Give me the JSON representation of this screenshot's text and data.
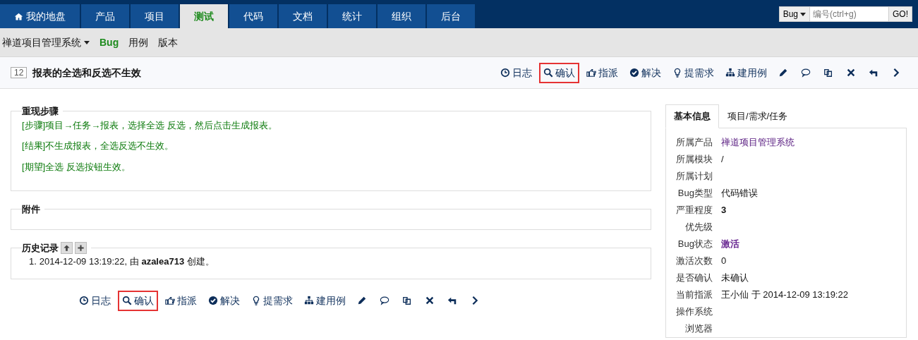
{
  "main_nav": {
    "items": [
      {
        "label": "我的地盘",
        "kind": "home",
        "selected": false
      },
      {
        "label": "产品",
        "kind": "plain",
        "selected": false
      },
      {
        "label": "项目",
        "kind": "plain",
        "selected": false
      },
      {
        "label": "测试",
        "kind": "plain",
        "selected": true
      },
      {
        "label": "代码",
        "kind": "plain",
        "selected": false
      },
      {
        "label": "文档",
        "kind": "plain",
        "selected": false
      },
      {
        "label": "统计",
        "kind": "plain",
        "selected": false
      },
      {
        "label": "组织",
        "kind": "plain",
        "selected": false
      },
      {
        "label": "后台",
        "kind": "plain",
        "selected": false
      }
    ],
    "search": {
      "type": "Bug",
      "placeholder": "编号(ctrl+g)",
      "button": "GO!"
    }
  },
  "sub_nav": {
    "product": "禅道项目管理系统",
    "items": [
      {
        "label": "Bug",
        "selected": true
      },
      {
        "label": "用例",
        "selected": false
      },
      {
        "label": "版本",
        "selected": false
      }
    ]
  },
  "title_bar": {
    "id": "12",
    "title": "报表的全选和反选不生效"
  },
  "toolbars": [
    {
      "actions": [
        {
          "kind": "clock",
          "label": "日志",
          "highlighted": false
        },
        {
          "kind": "search",
          "label": "确认",
          "highlighted": true
        },
        {
          "kind": "thumb",
          "label": "指派",
          "highlighted": false
        },
        {
          "kind": "check",
          "label": "解决",
          "highlighted": false
        },
        {
          "kind": "bulb",
          "label": "提需求",
          "highlighted": false
        },
        {
          "kind": "sitemap",
          "label": "建用例",
          "highlighted": false
        },
        {
          "kind": "pencil",
          "highlighted": false
        },
        {
          "kind": "comment",
          "highlighted": false
        },
        {
          "kind": "copy",
          "highlighted": false
        },
        {
          "kind": "close",
          "highlighted": false
        },
        {
          "kind": "back",
          "highlighted": false
        },
        {
          "kind": "next",
          "highlighted": false
        }
      ]
    },
    {
      "actions": [
        {
          "kind": "clock",
          "label": "日志",
          "highlighted": false
        },
        {
          "kind": "search",
          "label": "确认",
          "highlighted": true
        },
        {
          "kind": "thumb",
          "label": "指派",
          "highlighted": false
        },
        {
          "kind": "check",
          "label": "解决",
          "highlighted": false
        },
        {
          "kind": "bulb",
          "label": "提需求",
          "highlighted": false
        },
        {
          "kind": "sitemap",
          "label": "建用例",
          "highlighted": false
        },
        {
          "kind": "pencil",
          "highlighted": false
        },
        {
          "kind": "comment",
          "highlighted": false
        },
        {
          "kind": "copy",
          "highlighted": false
        },
        {
          "kind": "close",
          "highlighted": false
        },
        {
          "kind": "back",
          "highlighted": false
        },
        {
          "kind": "next",
          "highlighted": false
        }
      ]
    }
  ],
  "steps": {
    "legend": "重现步骤",
    "lines": [
      "[步骤]项目→任务→报表，选择全选 反选，然后点击生成报表。",
      "[结果]不生成报表，全选反选不生效。",
      "[期望]全选 反选按钮生效。"
    ]
  },
  "attachments": {
    "legend": "附件"
  },
  "history": {
    "legend": "历史记录",
    "entries": [
      {
        "number": "1.",
        "text": "2014-12-09 13:19:22, 由 **azalea713** 创建。"
      }
    ]
  },
  "side_panel": {
    "tabs": [
      {
        "label": "基本信息",
        "selected": true
      },
      {
        "label": "项目/需求/任务",
        "selected": false
      }
    ],
    "fields": [
      {
        "label": "所属产品",
        "value": "禅道项目管理系统",
        "kind": "link"
      },
      {
        "label": "所属模块",
        "value": "/",
        "kind": "text"
      },
      {
        "label": "所属计划"
      },
      {
        "label": "Bug类型",
        "value": "代码错误",
        "kind": "text"
      },
      {
        "label": "严重程度",
        "value": "3",
        "kind": "strong"
      },
      {
        "label": "优先级"
      },
      {
        "label": "Bug状态",
        "value": "激活",
        "kind": "status"
      },
      {
        "label": "激活次数",
        "value": "0",
        "kind": "text"
      },
      {
        "label": "是否确认",
        "value": "未确认",
        "kind": "text"
      },
      {
        "label": "当前指派",
        "value": "王小仙 于 2014-12-09 13:19:22",
        "kind": "text"
      },
      {
        "label": "操作系统"
      },
      {
        "label": "浏览器"
      }
    ]
  }
}
